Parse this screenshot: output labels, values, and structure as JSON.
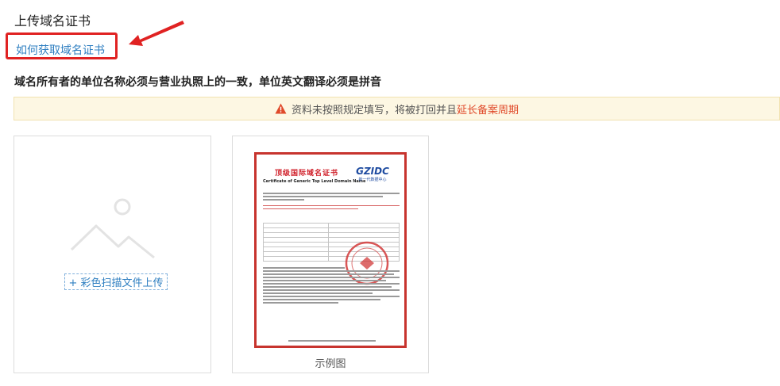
{
  "section_title": "上传域名证书",
  "help_link": "如何获取域名证书",
  "requirement": "域名所有者的单位名称必须与营业执照上的一致，单位英文翻译必须是拼音",
  "warning": {
    "text": "资料未按照规定填写，将被打回并且",
    "highlight": "延长备案周期",
    "color": "#e04a2a"
  },
  "upload": {
    "button_label": "+ 彩色扫描文件上传"
  },
  "sample": {
    "caption": "示例图",
    "certificate": {
      "title_cn": "顶级国际域名证书",
      "title_en": "Certificate of Generic Top Level Domain Name",
      "logo_main": "GZIDC",
      "logo_sub": "新一代数据中心"
    }
  },
  "colors": {
    "link": "#2f7fc1",
    "highlight_box": "#e02222",
    "warning_bg": "#fdf7e3"
  }
}
